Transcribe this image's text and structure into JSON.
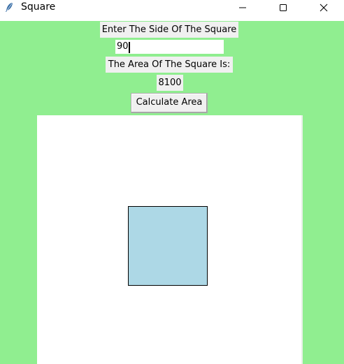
{
  "window": {
    "title": "Square",
    "icon": "feather-icon",
    "controls": [
      "minimize-icon",
      "maximize-icon",
      "close-icon"
    ]
  },
  "form": {
    "prompt_label": "Enter The Side Of The Square",
    "side_value": "90",
    "result_label": "The Area Of The Square Is:",
    "area_value": "8100",
    "calculate_button": "Calculate Area"
  },
  "canvas": {
    "square_fill": "#add8e6",
    "square_outline": "#000000",
    "background": "#ffffff"
  },
  "colors": {
    "window_background": "#90ee90",
    "label_background": "#f0f0f0"
  }
}
